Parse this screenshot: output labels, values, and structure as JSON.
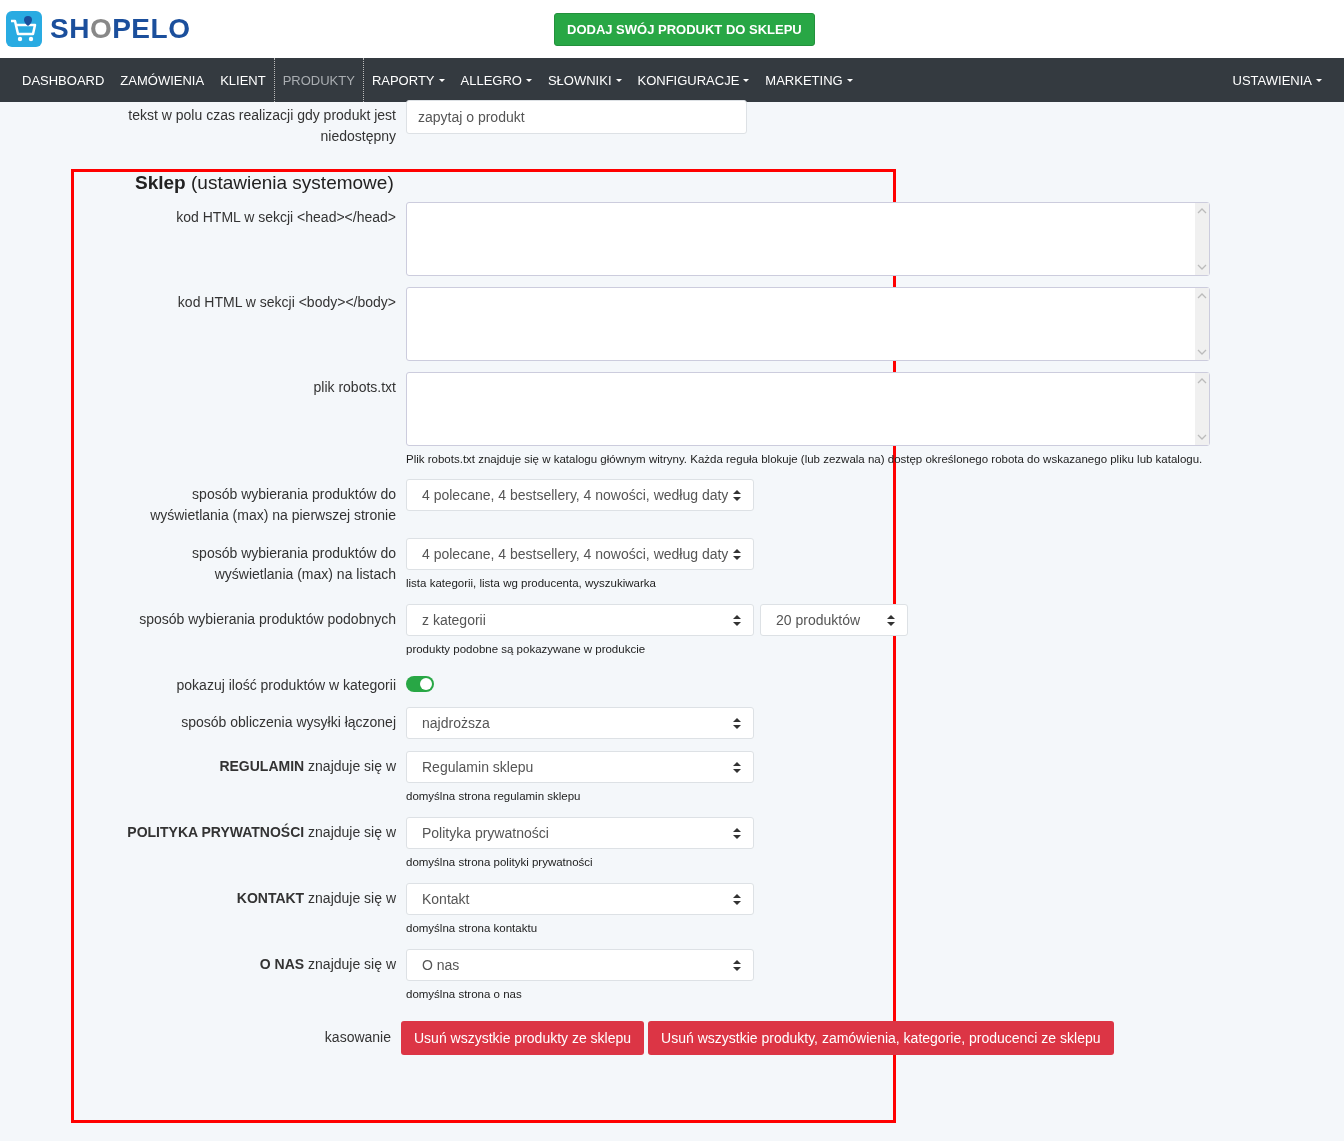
{
  "header": {
    "logo_parts": [
      {
        "text": "SH",
        "accent": false
      },
      {
        "text": "O",
        "accent": true
      },
      {
        "text": "PELO",
        "accent": false
      }
    ],
    "cta": "DODAJ SWÓJ PRODUKT DO SKLEPU"
  },
  "nav": {
    "items": [
      {
        "label": "DASHBOARD",
        "dropdown": false,
        "selected": false
      },
      {
        "label": "ZAMÓWIENIA",
        "dropdown": false,
        "selected": false
      },
      {
        "label": "KLIENT",
        "dropdown": false,
        "selected": false
      },
      {
        "label": "PRODUKTY",
        "dropdown": false,
        "selected": true
      },
      {
        "label": "RAPORTY",
        "dropdown": true,
        "selected": false
      },
      {
        "label": "ALLEGRO",
        "dropdown": true,
        "selected": false
      },
      {
        "label": "SŁOWNIKI",
        "dropdown": true,
        "selected": false
      },
      {
        "label": "KONFIGURACJE",
        "dropdown": true,
        "selected": false
      },
      {
        "label": "MARKETING",
        "dropdown": true,
        "selected": false
      }
    ],
    "right_item": {
      "label": "USTAWIENIA",
      "dropdown": true
    }
  },
  "top_field": {
    "label": "tekst w polu czas realizacji gdy produkt jest niedostępny",
    "value": "zapytaj o produkt"
  },
  "section": {
    "title": "**Sklep** (ustawienia systemowe)",
    "fields": [
      {
        "kind": "textarea",
        "label": "kod HTML w sekcji <head></head>"
      },
      {
        "kind": "textarea",
        "label": "kod HTML w sekcji <body></body>"
      },
      {
        "kind": "textarea",
        "label": "plik robots.txt",
        "help": "Plik robots.txt znajduje się w katalogu głównym witryny. Każda reguła blokuje (lub zezwala na) dostęp określonego robota do wskazanego pliku lub katalogu."
      },
      {
        "kind": "select",
        "label": "sposób wybierania produktów do wyświetlania (max) na pierwszej stronie",
        "value": "4 polecane, 4 bestsellery, 4 nowości, według daty"
      },
      {
        "kind": "select",
        "label": "sposób wybierania produktów do wyświetlania (max) na listach",
        "value": "4 polecane, 4 bestsellery, 4 nowości, według daty",
        "help": "lista kategorii, lista wg producenta, wyszukiwarka"
      },
      {
        "kind": "select_pair",
        "label": "sposób wybierania produktów podobnych",
        "value": "z kategorii",
        "value_2": "20 produktów",
        "help": "produkty podobne są pokazywane w produkcie"
      },
      {
        "kind": "toggle",
        "label": "pokazuj ilość produktów w kategorii",
        "on": true
      },
      {
        "kind": "select",
        "label": "sposób obliczenia wysyłki łączonej",
        "value": "najdroższa"
      },
      {
        "kind": "select",
        "label": "**REGULAMIN** znajduje się w",
        "value": "Regulamin sklepu",
        "help": "domyślna strona regulamin sklepu"
      },
      {
        "kind": "select",
        "label": "**POLITYKA PRYWATNOŚCI** znajduje się w",
        "value": "Polityka prywatności",
        "help": "domyślna strona polityki prywatności"
      },
      {
        "kind": "select",
        "label": "**KONTAKT** znajduje się w",
        "value": "Kontakt",
        "help": "domyślna strona kontaktu"
      },
      {
        "kind": "select",
        "label": "**O NAS** znajduje się w",
        "value": "O nas",
        "help": "domyślna strona o nas"
      },
      {
        "kind": "buttons",
        "label": "kasowanie",
        "buttons": [
          "Usuń wszystkie produkty ze sklepu",
          "Usuń wszystkie produkty, zamówienia, kategorie, producenci ze sklepu"
        ]
      }
    ]
  }
}
